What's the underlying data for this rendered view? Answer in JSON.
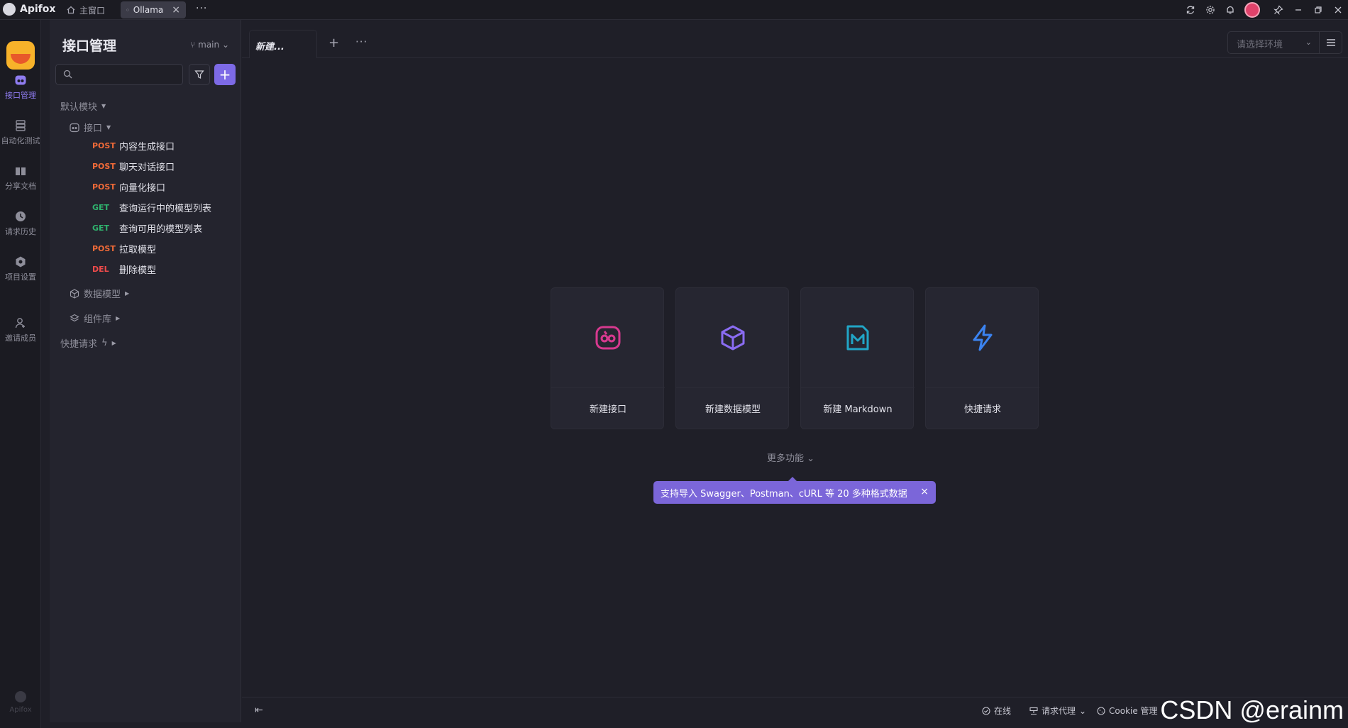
{
  "titlebar": {
    "app_name": "Apifox",
    "tabs": [
      {
        "label": "主窗口"
      },
      {
        "label": "Ollama"
      }
    ],
    "more": "···"
  },
  "rail": {
    "items": [
      {
        "label": "接口管理",
        "icon": "api-icon"
      },
      {
        "label": "自动化测试",
        "icon": "automation-icon"
      },
      {
        "label": "分享文档",
        "icon": "book-icon"
      },
      {
        "label": "请求历史",
        "icon": "clock-icon"
      },
      {
        "label": "项目设置",
        "icon": "settings-icon"
      },
      {
        "label": "邀请成员",
        "icon": "add-user-icon"
      }
    ],
    "footer": "Apifox"
  },
  "sidebar": {
    "title": "接口管理",
    "branch": "main",
    "default_module": "默认模块",
    "interfaces_folder": "接口",
    "apis": [
      {
        "method": "POST",
        "name": "内容生成接口"
      },
      {
        "method": "POST",
        "name": "聊天对话接口"
      },
      {
        "method": "POST",
        "name": "向量化接口"
      },
      {
        "method": "GET",
        "name": "查询运行中的模型列表"
      },
      {
        "method": "GET",
        "name": "查询可用的模型列表"
      },
      {
        "method": "POST",
        "name": "拉取模型"
      },
      {
        "method": "DEL",
        "name": "删除模型"
      }
    ],
    "data_models": "数据模型",
    "components": "组件库",
    "quick_requests": "快捷请求"
  },
  "main": {
    "tab_label": "新建...",
    "env_placeholder": "请选择环境",
    "cards": [
      {
        "label": "新建接口",
        "icon": "api-icon",
        "color": "#d7398f"
      },
      {
        "label": "新建数据模型",
        "icon": "cube-icon",
        "color": "#8a6cf2"
      },
      {
        "label": "新建 Markdown",
        "icon": "markdown-icon",
        "color": "#21a5c6"
      },
      {
        "label": "快捷请求",
        "icon": "bolt-icon",
        "color": "#3b83f0"
      }
    ],
    "more_features": "更多功能",
    "tip": "支持导入 Swagger、Postman、cURL 等 20 多种格式数据"
  },
  "statusbar": {
    "online": "在线",
    "proxy": "请求代理",
    "cookie": "Cookie 管理"
  },
  "watermark": "CSDN @erainm",
  "colors": {
    "accent": "#7d6ae6",
    "post": "#f06a38",
    "get": "#2fb36e",
    "delete": "#ef4b4b"
  }
}
